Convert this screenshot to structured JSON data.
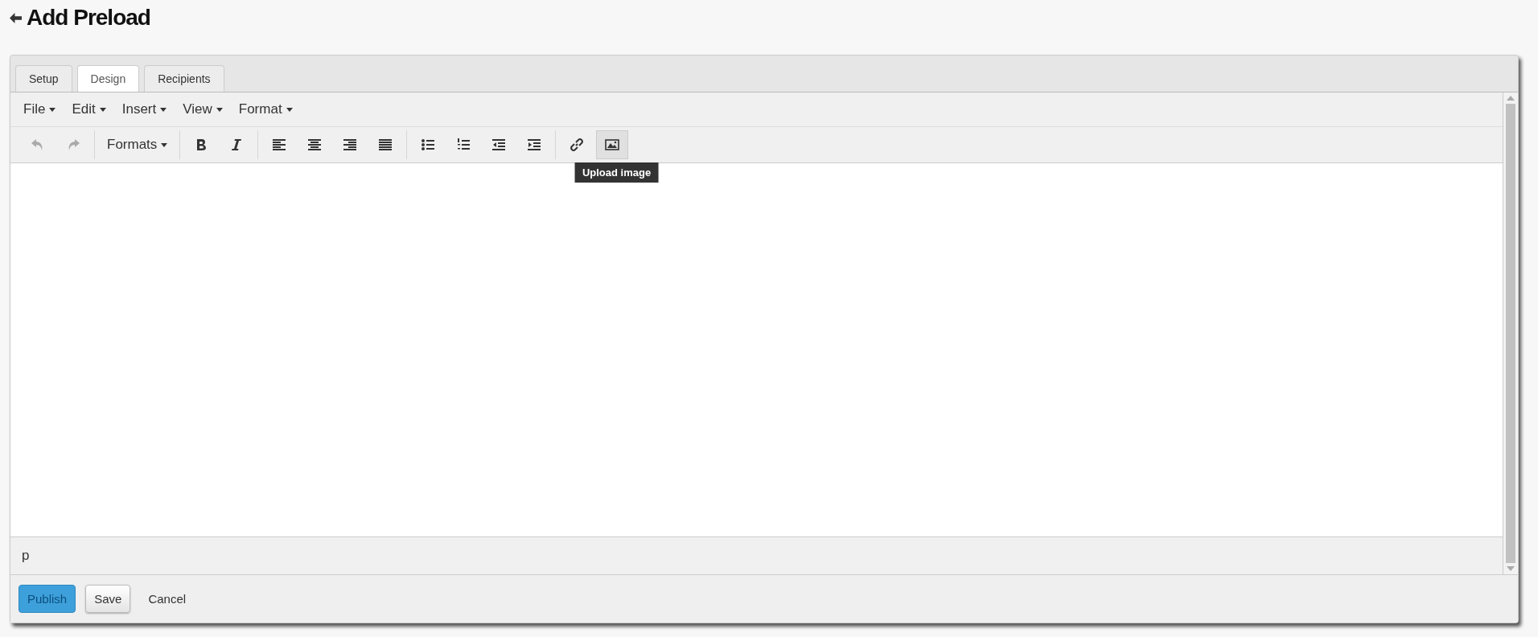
{
  "page": {
    "title": "Add Preload"
  },
  "tabs": [
    {
      "label": "Setup",
      "selected": false
    },
    {
      "label": "Design",
      "selected": true
    },
    {
      "label": "Recipients",
      "selected": false
    }
  ],
  "menubar": [
    "File",
    "Edit",
    "Insert",
    "View",
    "Format"
  ],
  "toolbar": [
    [
      {
        "kind": "undo",
        "disabled": true
      },
      {
        "kind": "redo",
        "disabled": true
      }
    ],
    [
      {
        "kind": "dropdown",
        "label": "Formats"
      }
    ],
    [
      {
        "kind": "bold"
      },
      {
        "kind": "italic"
      }
    ],
    [
      {
        "kind": "align-left"
      },
      {
        "kind": "align-center"
      },
      {
        "kind": "align-right"
      },
      {
        "kind": "align-justify"
      }
    ],
    [
      {
        "kind": "bullet-list"
      },
      {
        "kind": "numbered-list"
      },
      {
        "kind": "outdent"
      },
      {
        "kind": "indent"
      }
    ],
    [
      {
        "kind": "link"
      },
      {
        "kind": "image",
        "hovered": true,
        "tooltip": "Upload image"
      }
    ]
  ],
  "status_path": "p",
  "buttons": [
    {
      "label": "Publish",
      "kind": "primary",
      "disabled": true
    },
    {
      "label": "Save",
      "kind": "default"
    },
    {
      "label": "Cancel",
      "kind": "link"
    }
  ]
}
